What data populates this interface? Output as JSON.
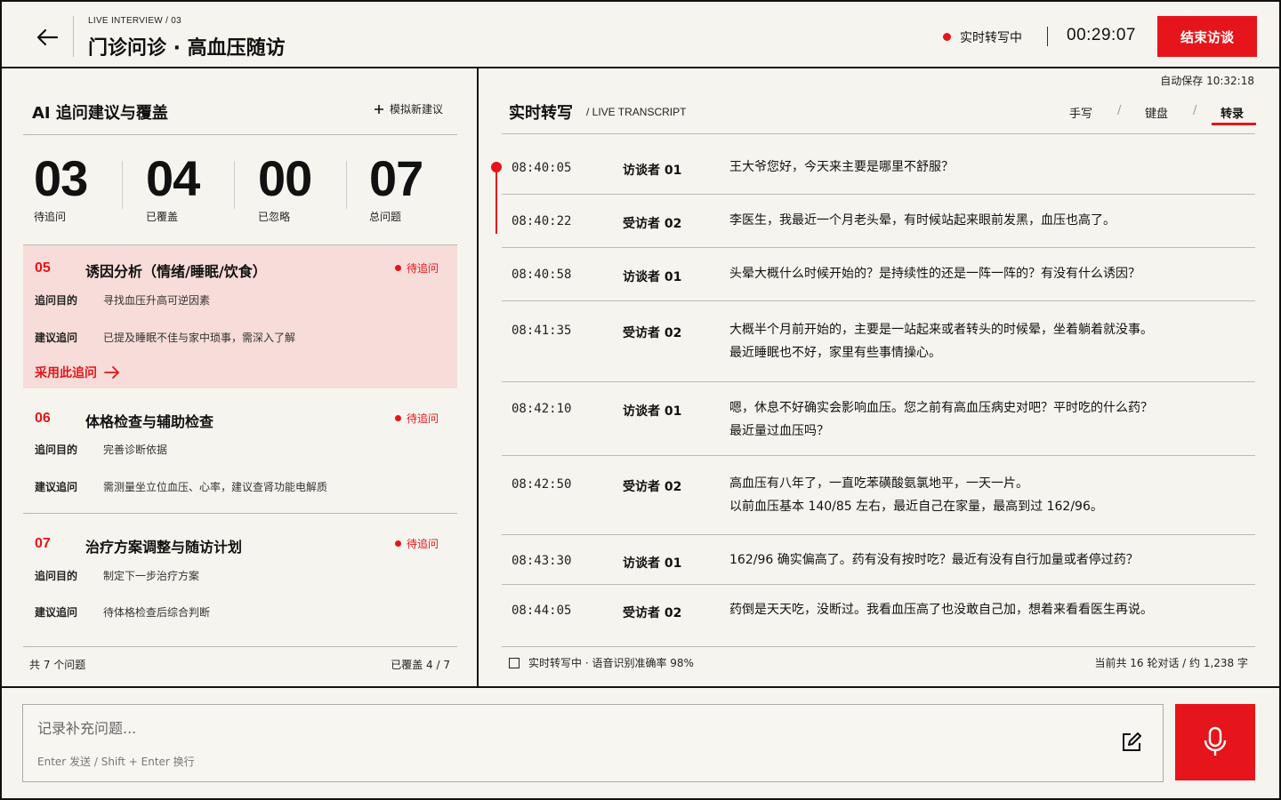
{
  "header": {
    "kicker": "LIVE INTERVIEW / 03",
    "title": "门诊问诊 · 高血压随访",
    "rec_status": "实时转写中",
    "timer": "00:29:07",
    "end_button": "结束访谈"
  },
  "left": {
    "title": "AI 追问建议与覆盖",
    "sim_button": "模拟新建议",
    "stats": [
      {
        "num": "03",
        "label": "待追问"
      },
      {
        "num": "04",
        "label": "已覆盖"
      },
      {
        "num": "00",
        "label": "已忽略"
      },
      {
        "num": "07",
        "label": "总问题"
      }
    ],
    "cards": [
      {
        "num": "05",
        "title": "诱因分析（情绪/睡眠/饮食）",
        "status": "待追问",
        "k1": "追问目的",
        "v1": "寻找血压升高可逆因素",
        "k2": "建议追问",
        "v2": "已提及睡眠不佳与家中琐事，需深入了解",
        "adopt": "采用此追问"
      },
      {
        "num": "06",
        "title": "体格检查与辅助检查",
        "status": "待追问",
        "k1": "追问目的",
        "v1": "完善诊断依据",
        "k2": "建议追问",
        "v2": "需测量坐立位血压、心率，建议查肾功能电解质"
      },
      {
        "num": "07",
        "title": "治疗方案调整与随访计划",
        "status": "待追问",
        "k1": "追问目的",
        "v1": "制定下一步治疗方案",
        "k2": "建议追问",
        "v2": "待体格检查后综合判断"
      }
    ],
    "footer_left": "共 7 个问题",
    "footer_right": "已覆盖 4 / 7"
  },
  "right": {
    "autosave": "自动保存 10:32:18",
    "title": "实时转写",
    "subtitle": "/ LIVE TRANSCRIPT",
    "modes": [
      "手写",
      "键盘",
      "转录"
    ],
    "active_mode": "转录",
    "transcript": [
      {
        "time": "08:40:05",
        "speaker": "访谈者 01",
        "text": "王大爷您好，今天来主要是哪里不舒服？"
      },
      {
        "time": "08:40:22",
        "speaker": "受访者 02",
        "text": "李医生，我最近一个月老头晕，有时候站起来眼前发黑，血压也高了。"
      },
      {
        "time": "08:40:58",
        "speaker": "访谈者 01",
        "text": "头晕大概什么时候开始的？是持续性的还是一阵一阵的？有没有什么诱因？"
      },
      {
        "time": "08:41:35",
        "speaker": "受访者 02",
        "text": "大概半个月前开始的，主要是一站起来或者转头的时候晕，坐着躺着就没事。",
        "text2": "最近睡眠也不好，家里有些事情操心。"
      },
      {
        "time": "08:42:10",
        "speaker": "访谈者 01",
        "text": "嗯，休息不好确实会影响血压。您之前有高血压病史对吧？平时吃的什么药？",
        "text2": "最近量过血压吗？"
      },
      {
        "time": "08:42:50",
        "speaker": "受访者 02",
        "text": "高血压有八年了，一直吃苯磺酸氨氯地平，一天一片。",
        "text2": "以前血压基本 140/85 左右，最近自己在家量，最高到过 162/96。"
      },
      {
        "time": "08:43:30",
        "speaker": "访谈者 01",
        "text": "162/96 确实偏高了。药有没有按时吃？最近有没有自行加量或者停过药？"
      },
      {
        "time": "08:44:05",
        "speaker": "受访者 02",
        "text": "药倒是天天吃，没断过。我看血压高了也没敢自己加，想着来看看医生再说。"
      }
    ],
    "footer_left": "实时转写中 · 语音识别准确率 98%",
    "footer_right": "当前共 16 轮对话 / 约 1,238 字"
  },
  "input": {
    "placeholder": "记录补充问题...",
    "hint": "Enter 发送  /  Shift + Enter 换行"
  },
  "colors": {
    "accent": "#e5151b",
    "background": "#f6f4ee",
    "active_card": "#f7dcd9"
  }
}
